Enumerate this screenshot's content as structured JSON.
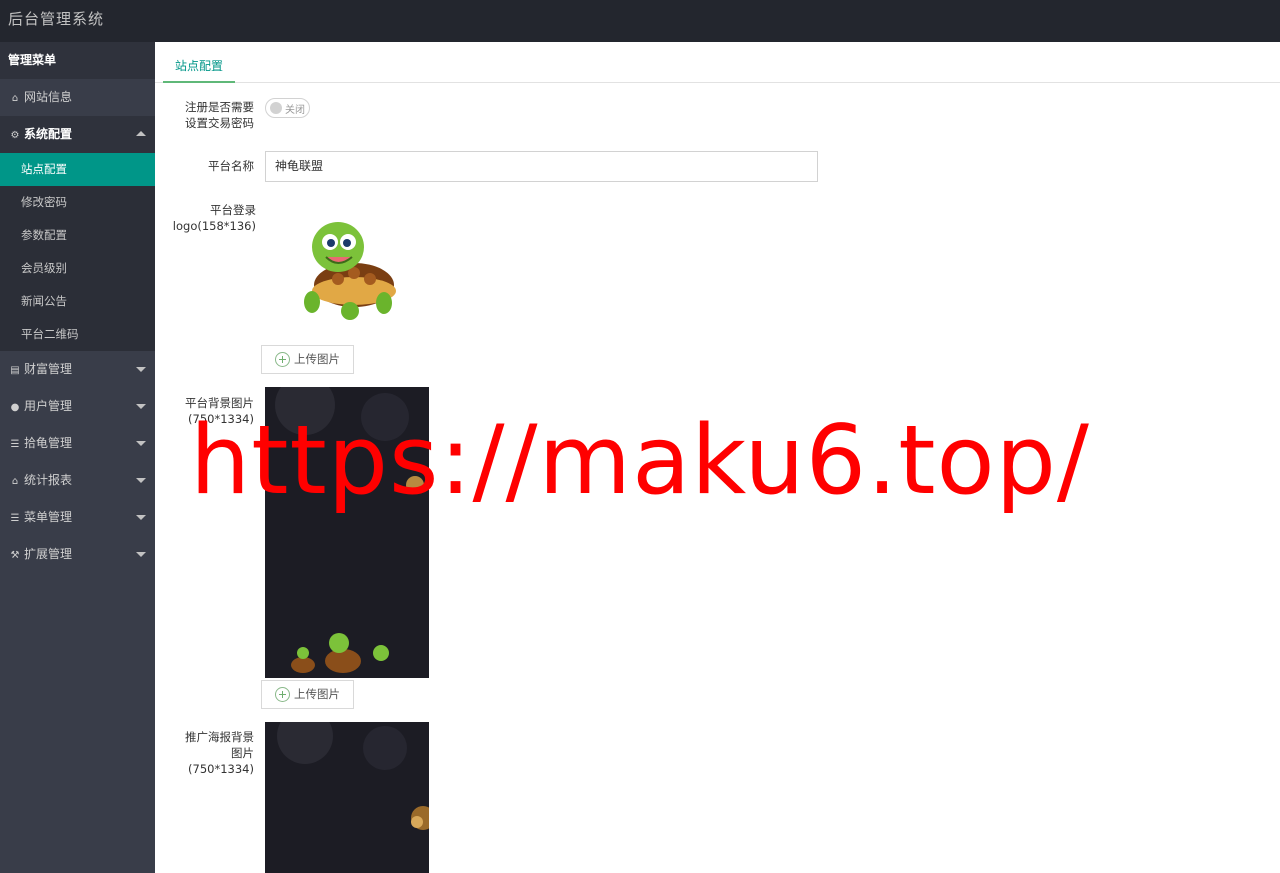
{
  "app": {
    "title": "后台管理系统"
  },
  "sidebar": {
    "header": "管理菜单",
    "items": [
      {
        "icon": "home-icon",
        "label": "网站信息"
      },
      {
        "icon": "gears-icon",
        "label": "系统配置",
        "open": true,
        "children": [
          "站点配置",
          "修改密码",
          "参数配置",
          "会员级别",
          "新闻公告",
          "平台二维码"
        ]
      },
      {
        "icon": "money-icon",
        "label": "财富管理"
      },
      {
        "icon": "users-icon",
        "label": "用户管理"
      },
      {
        "icon": "list-icon",
        "label": "拾龟管理"
      },
      {
        "icon": "home-icon",
        "label": "统计报表"
      },
      {
        "icon": "list-icon",
        "label": "菜单管理"
      },
      {
        "icon": "wrench-icon",
        "label": "扩展管理"
      }
    ],
    "active_child": "站点配置"
  },
  "tabs": {
    "active": "站点配置"
  },
  "form": {
    "register_trade_pwd": {
      "label_line1": "注册是否需要",
      "label_line2": "设置交易密码",
      "state": "关闭"
    },
    "platform_name": {
      "label": "平台名称",
      "value": "神龟联盟"
    },
    "platform_logo": {
      "label_line1": "平台登录",
      "label_line2": "logo(158*136)"
    },
    "platform_bg": {
      "label_line1": "平台背景图片",
      "label_line2": "(750*1334)"
    },
    "promo_bg": {
      "label_line1": "推广海报背景",
      "label_line2": "图片",
      "label_line3": "(750*1334)"
    },
    "upload_label": "上传图片"
  },
  "watermark": "https://maku6.top/",
  "colors": {
    "topbar": "#23262e",
    "sidebar": "#393d49",
    "active": "#009688",
    "tab_underline": "#5fb878",
    "watermark": "#ff0000"
  }
}
